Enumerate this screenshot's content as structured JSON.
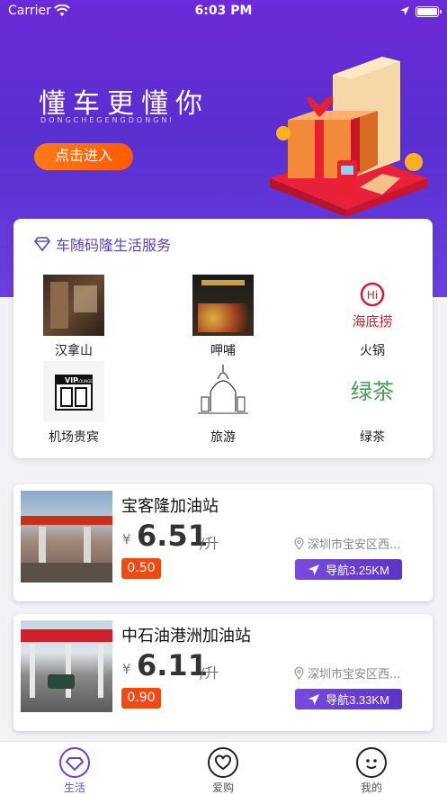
{
  "status_bar": {
    "carrier": "Carrier",
    "time": "6:03 PM"
  },
  "banner": {
    "title": "懂车更懂你",
    "subtitle": "DONGCHEGENGDONGNI",
    "enter_button": "点击进入"
  },
  "services": {
    "title": "车随码隆生活服务",
    "items": [
      {
        "label": "汉拿山",
        "icon": "restaurant-thumbnail"
      },
      {
        "label": "呷哺",
        "icon": "restaurant-thumbnail"
      },
      {
        "label": "火锅",
        "icon": "haidilao-logo"
      },
      {
        "label": "机场贵宾",
        "icon": "vip-lounge-logo"
      },
      {
        "label": "旅游",
        "icon": "cathedral-sketch"
      },
      {
        "label": "绿茶",
        "icon": "green-tea-logo"
      }
    ],
    "logo_text": {
      "haidilao": "海底捞",
      "vip": "VIP",
      "lounge": "LOUNGE",
      "lvcha": "绿茶"
    }
  },
  "stations": [
    {
      "name": "宝客隆加油站",
      "currency": "¥",
      "price": "6.51",
      "unit": "/升",
      "discount": "0.50",
      "address": "深圳市宝安区西...",
      "navigate": "导航3.25KM"
    },
    {
      "name": "中石油港洲加油站",
      "currency": "¥",
      "price": "6.11",
      "unit": "/升",
      "discount": "0.90",
      "address": "深圳市宝安区西...",
      "navigate": "导航3.33KM"
    }
  ],
  "tabs": [
    {
      "label": "生活",
      "icon": "diamond-icon",
      "active": true
    },
    {
      "label": "爱购",
      "icon": "heart-icon",
      "active": false
    },
    {
      "label": "我的",
      "icon": "profile-icon",
      "active": false
    }
  ],
  "colors": {
    "primary": "#6a3fd9",
    "accent": "#ff6a00",
    "discount": "#f04a14"
  }
}
